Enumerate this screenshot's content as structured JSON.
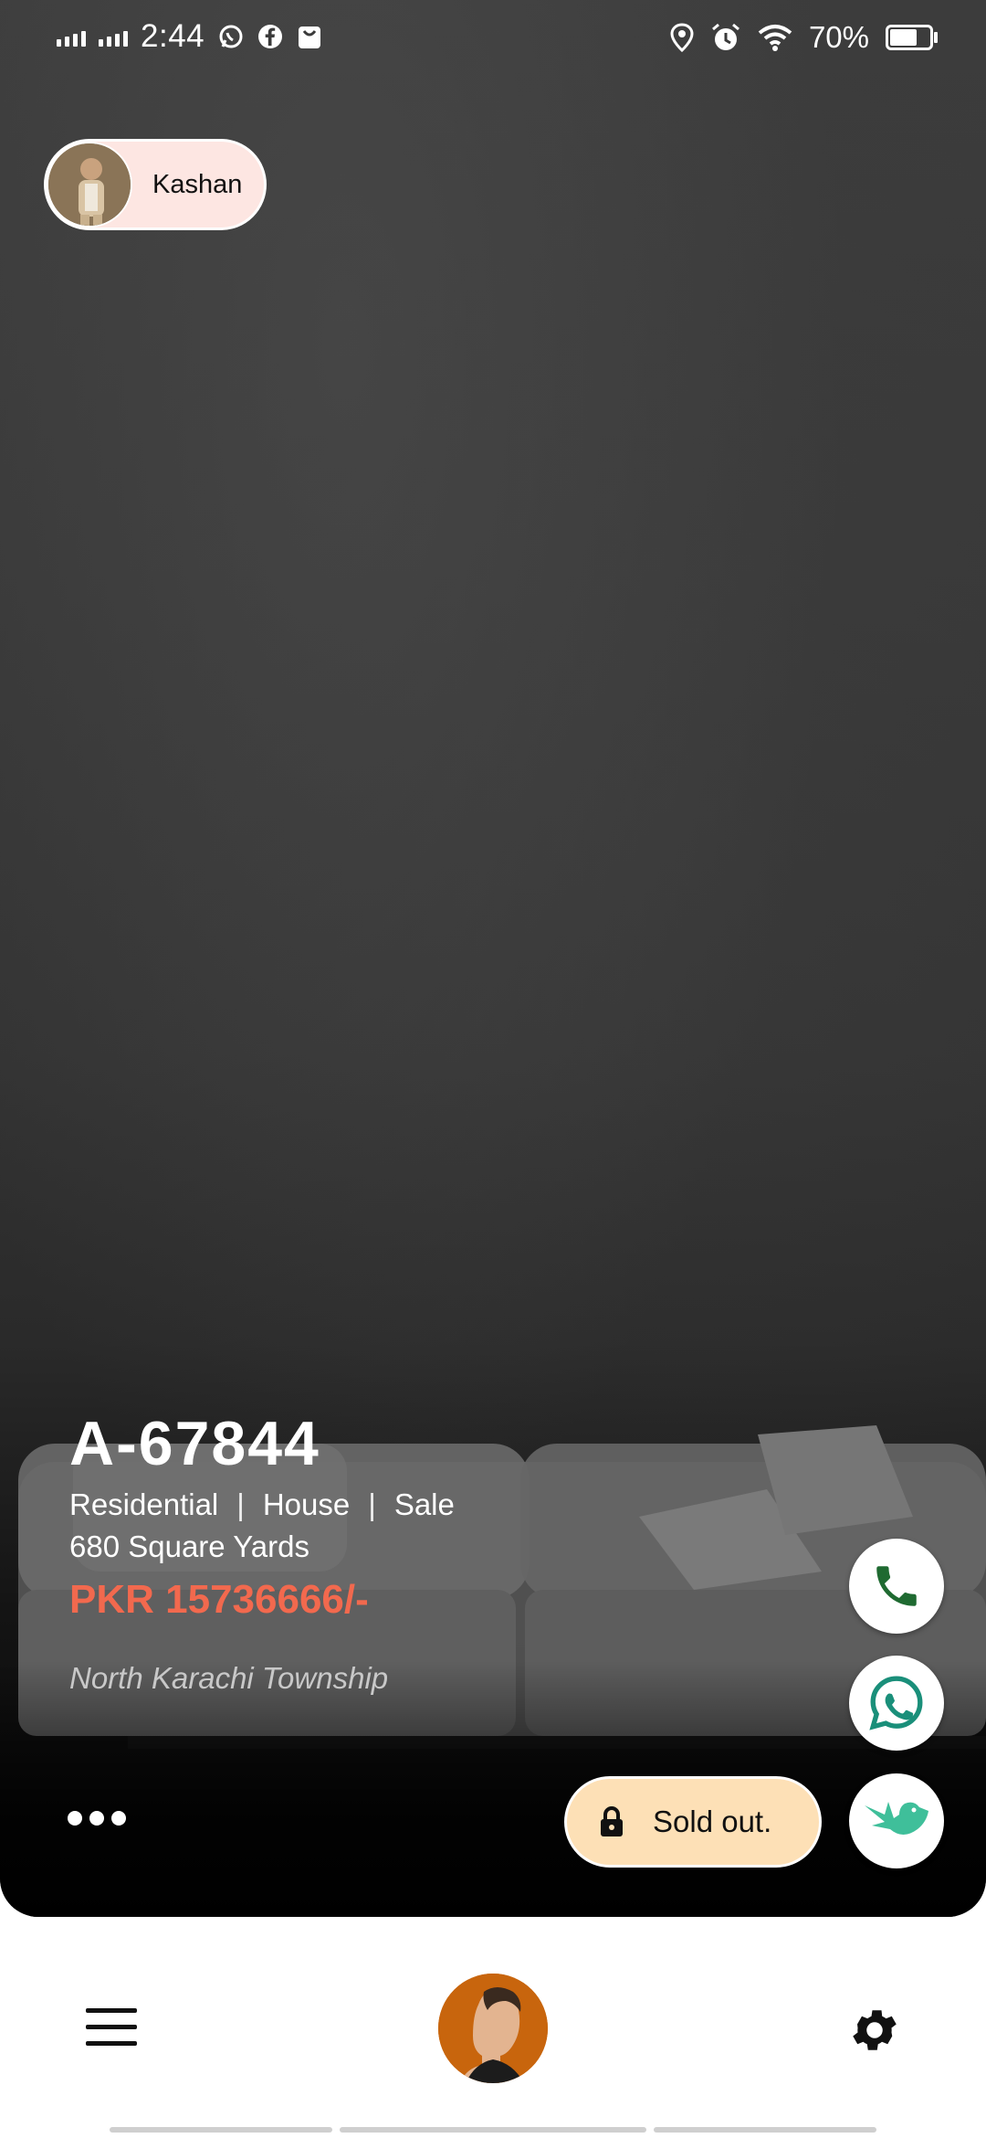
{
  "status_bar": {
    "time": "2:44",
    "battery": "70%",
    "battery_level": 0.7,
    "left_icons": [
      "signal-icon",
      "signal-icon",
      "whatsapp-icon",
      "facebook-icon",
      "shopping-bag-icon"
    ],
    "right_icons": [
      "location-icon",
      "alarm-icon",
      "wifi-icon",
      "battery-icon"
    ]
  },
  "agent": {
    "name": "Kashan"
  },
  "property": {
    "id": "A-67844",
    "category": "Residential",
    "type": "House",
    "purpose": "Sale",
    "separator": "|",
    "size": "680 Square Yards",
    "price": "PKR 15736666/-",
    "location": "North Karachi Township"
  },
  "actions": {
    "sold_out_label": "Sold out.",
    "call_icon": "phone-icon",
    "whatsapp_icon": "whatsapp-icon",
    "share_icon": "bird-icon",
    "more_icon": "more-dots-icon"
  },
  "colors": {
    "price": "#f2694e",
    "agent_chip": "#fde6e2",
    "sold_out_chip": "#fde0b6",
    "phone_icon": "#1f6a31",
    "whatsapp_icon": "#1a8f7a",
    "bird_icon": "#3fbf9a",
    "nav_avatar_bg": "#c8650d"
  },
  "bottom_nav": {
    "items": [
      "menu-icon",
      "profile-avatar",
      "settings-icon"
    ]
  }
}
